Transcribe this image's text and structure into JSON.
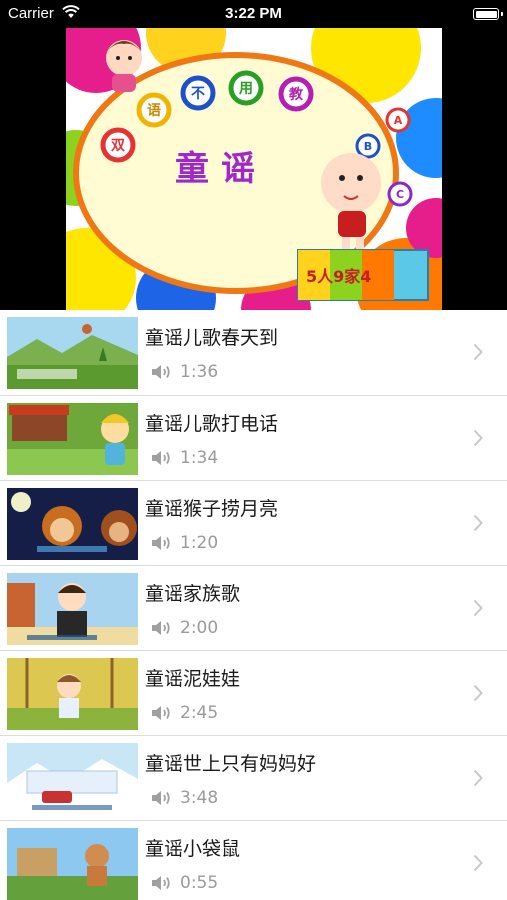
{
  "status_bar": {
    "carrier": "Carrier",
    "time": "3:22 PM"
  },
  "banner": {
    "title": "童谣",
    "ball_letters": [
      "双",
      "语",
      "不",
      "用",
      "教"
    ],
    "abc_letters": [
      "A",
      "B",
      "C"
    ],
    "blocks_text": "5人9家4"
  },
  "songs": [
    {
      "title": "童谣儿歌春天到",
      "duration": "1:36",
      "thumb": "spring"
    },
    {
      "title": "童谣儿歌打电话",
      "duration": "1:34",
      "thumb": "phone"
    },
    {
      "title": "童谣猴子捞月亮",
      "duration": "1:20",
      "thumb": "monkey"
    },
    {
      "title": "童谣家族歌",
      "duration": "2:00",
      "thumb": "family"
    },
    {
      "title": "童谣泥娃娃",
      "duration": "2:45",
      "thumb": "doll"
    },
    {
      "title": "童谣世上只有妈妈好",
      "duration": "3:48",
      "thumb": "mom"
    },
    {
      "title": "童谣小袋鼠",
      "duration": "0:55",
      "thumb": "kangaroo"
    }
  ],
  "icons": {
    "wifi": "wifi-icon",
    "battery": "battery-icon",
    "speaker": "speaker-icon",
    "chevron": "chevron-right-icon"
  },
  "colors": {
    "duration_text": "#9a9a9a",
    "separator": "#dcdcdc",
    "status_bar": "#000000"
  }
}
